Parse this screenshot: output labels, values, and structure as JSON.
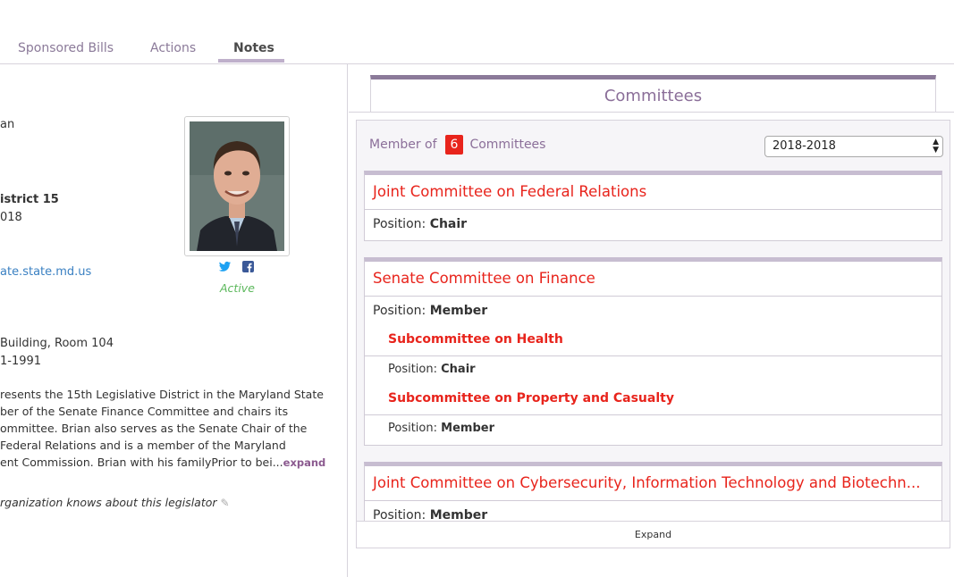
{
  "tabs": [
    {
      "label": "Sponsored Bills"
    },
    {
      "label": "Actions"
    },
    {
      "label": "Notes"
    }
  ],
  "profile": {
    "line1": "an",
    "district": "istrict 15",
    "term": "018",
    "email": "ate.state.md.us",
    "office": " Building, Room 104",
    "phone": "1-1991",
    "bio": [
      "resents the 15th Legislative District in the Maryland State",
      "ber of the Senate Finance Committee and chairs its",
      "ommittee. Brian also serves as the Senate Chair of the",
      "Federal Relations and is a member of the Maryland",
      "ent Commission. Brian with his familyPrior to bei..."
    ],
    "bio_expand": "expand",
    "note": "rganization knows about this legislator",
    "status": "Active",
    "social": [
      "twitter-icon",
      "facebook-icon"
    ]
  },
  "committees": {
    "header": "Committees",
    "member_prefix": "Member of",
    "count": "6",
    "member_suffix": "Committees",
    "year": "2018-2018",
    "position_label": "Position:",
    "items": [
      {
        "name": "Joint Committee on Federal Relations",
        "position": "Chair"
      },
      {
        "name": "Senate Committee on Finance",
        "position": "Member",
        "subs": [
          {
            "name": "Subcommittee on Health",
            "position": "Chair"
          },
          {
            "name": "Subcommittee on Property and Casualty",
            "position": "Member"
          }
        ]
      },
      {
        "name": "Joint Committee on Cybersecurity, Information Technology and Biotechn...",
        "position": "Member"
      }
    ],
    "expand_label": "Expand"
  },
  "colors": {
    "accent": "#8b6f99",
    "committee_red": "#e8241c",
    "active_green": "#5cb85c",
    "link_blue": "#3a80c2"
  }
}
